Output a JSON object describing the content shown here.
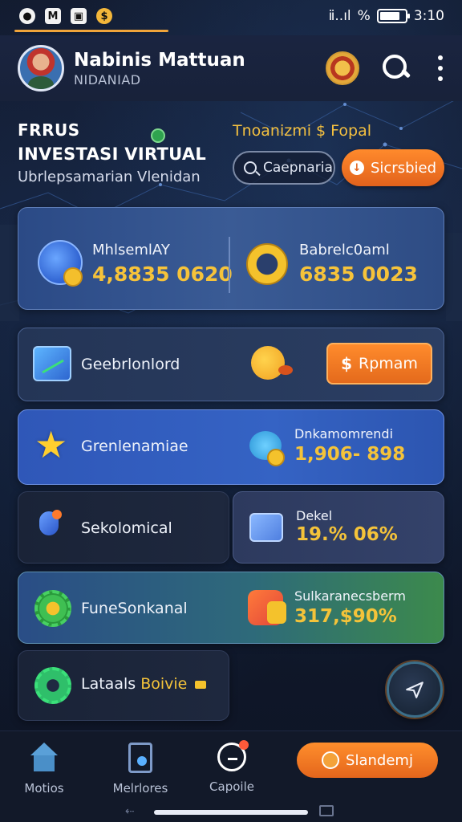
{
  "status_bar": {
    "time": "3:10",
    "left_icons": [
      "record-icon",
      "mail-icon",
      "gallery-icon",
      "coin-notification-icon"
    ],
    "left_glyphs": [
      "●",
      "M",
      "▣",
      "$"
    ],
    "right_icons": [
      "vibrate-icon",
      "signal-icon",
      "wifi-off-icon",
      "battery-icon"
    ],
    "signal_glyph": "ⅱ..ıl",
    "wifi_glyph": "%"
  },
  "header": {
    "user_name": "Nabinis Mattuan",
    "user_subtitle": "NIDANIAD"
  },
  "hero": {
    "line1": "FRRUS",
    "line2": "INVESTASI VIRTUAL",
    "line3": "Ubrlepsamarian Vlenidan",
    "promo_text": "Tnoanizmi $ Fopal",
    "search_button_label": "Caepnaria",
    "subscribed_button_label": "Sicrsbied",
    "subscribed_glyph": "↓"
  },
  "balance_card": {
    "left_label": "MhlsemlAY",
    "left_value": "4,8835 0620",
    "right_label": "Babrelc0aml",
    "right_value": "6835 0023"
  },
  "row_chart": {
    "label": "Geebrlonlord",
    "button_label": "Rpmam",
    "button_glyph": "$"
  },
  "row_blue": {
    "label": "Grenlenamiae",
    "right_label": "Dnkamomrendi",
    "right_value": "1,906- 898"
  },
  "row_social": {
    "label": "Sekolomical"
  },
  "row_debit": {
    "label": "Dekel",
    "value": "19.% 06%"
  },
  "row_green": {
    "label": "FuneSonkanal",
    "right_label": "Sulkaranecsberm",
    "right_value": "317,$90%"
  },
  "row_latest": {
    "label": "Lataals",
    "accent_label": "Boivie"
  },
  "bottom_nav": {
    "items": [
      {
        "label": "Motios"
      },
      {
        "label": "Melrlores"
      },
      {
        "label": "Capoile"
      }
    ],
    "cta_label": "Slandemj",
    "back_glyph": "⇠"
  },
  "colors": {
    "accent_orange": "#e8671c",
    "value_gold": "#f4c33a",
    "card_blue": "#3563c4",
    "background": "#0f1526"
  }
}
